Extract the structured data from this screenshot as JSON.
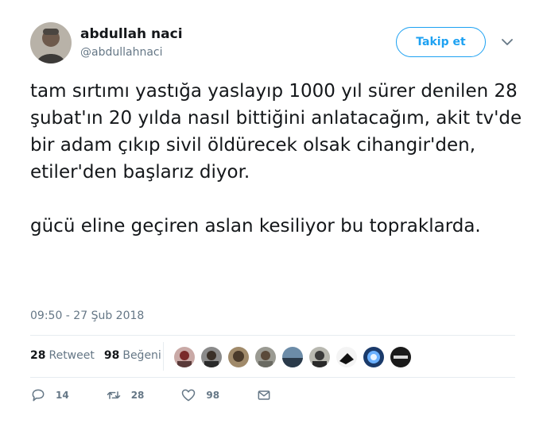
{
  "author": {
    "display_name": "abdullah naci",
    "handle": "@abdullahnaci",
    "avatar_icon": "user-avatar"
  },
  "follow_button": {
    "label": "Takip et"
  },
  "menu": {
    "icon": "chevron-down-icon"
  },
  "tweet": {
    "paragraph_1": "tam sırtımı yastığa yaslayıp 1000 yıl sürer denilen 28 şubat'ın 20 yılda nasıl bittiğini anlatacağım, akit tv'de bir adam çıkıp sivil öldürecek olsak cihangir'den, etiler'den başlarız diyor.",
    "paragraph_2": "gücü eline geçiren aslan kesiliyor bu topraklarda.",
    "timestamp": "09:50 - 27 Şub 2018"
  },
  "stats": {
    "retweets_count": "28",
    "retweets_label": "Retweet",
    "likes_count": "98",
    "likes_label": "Beğeni"
  },
  "likers_count": 9,
  "actions": {
    "reply_count": "14",
    "retweet_count": "28",
    "like_count": "98"
  },
  "colors": {
    "accent": "#1da1f2",
    "secondary_text": "#657786",
    "divider": "#e6ecf0"
  }
}
